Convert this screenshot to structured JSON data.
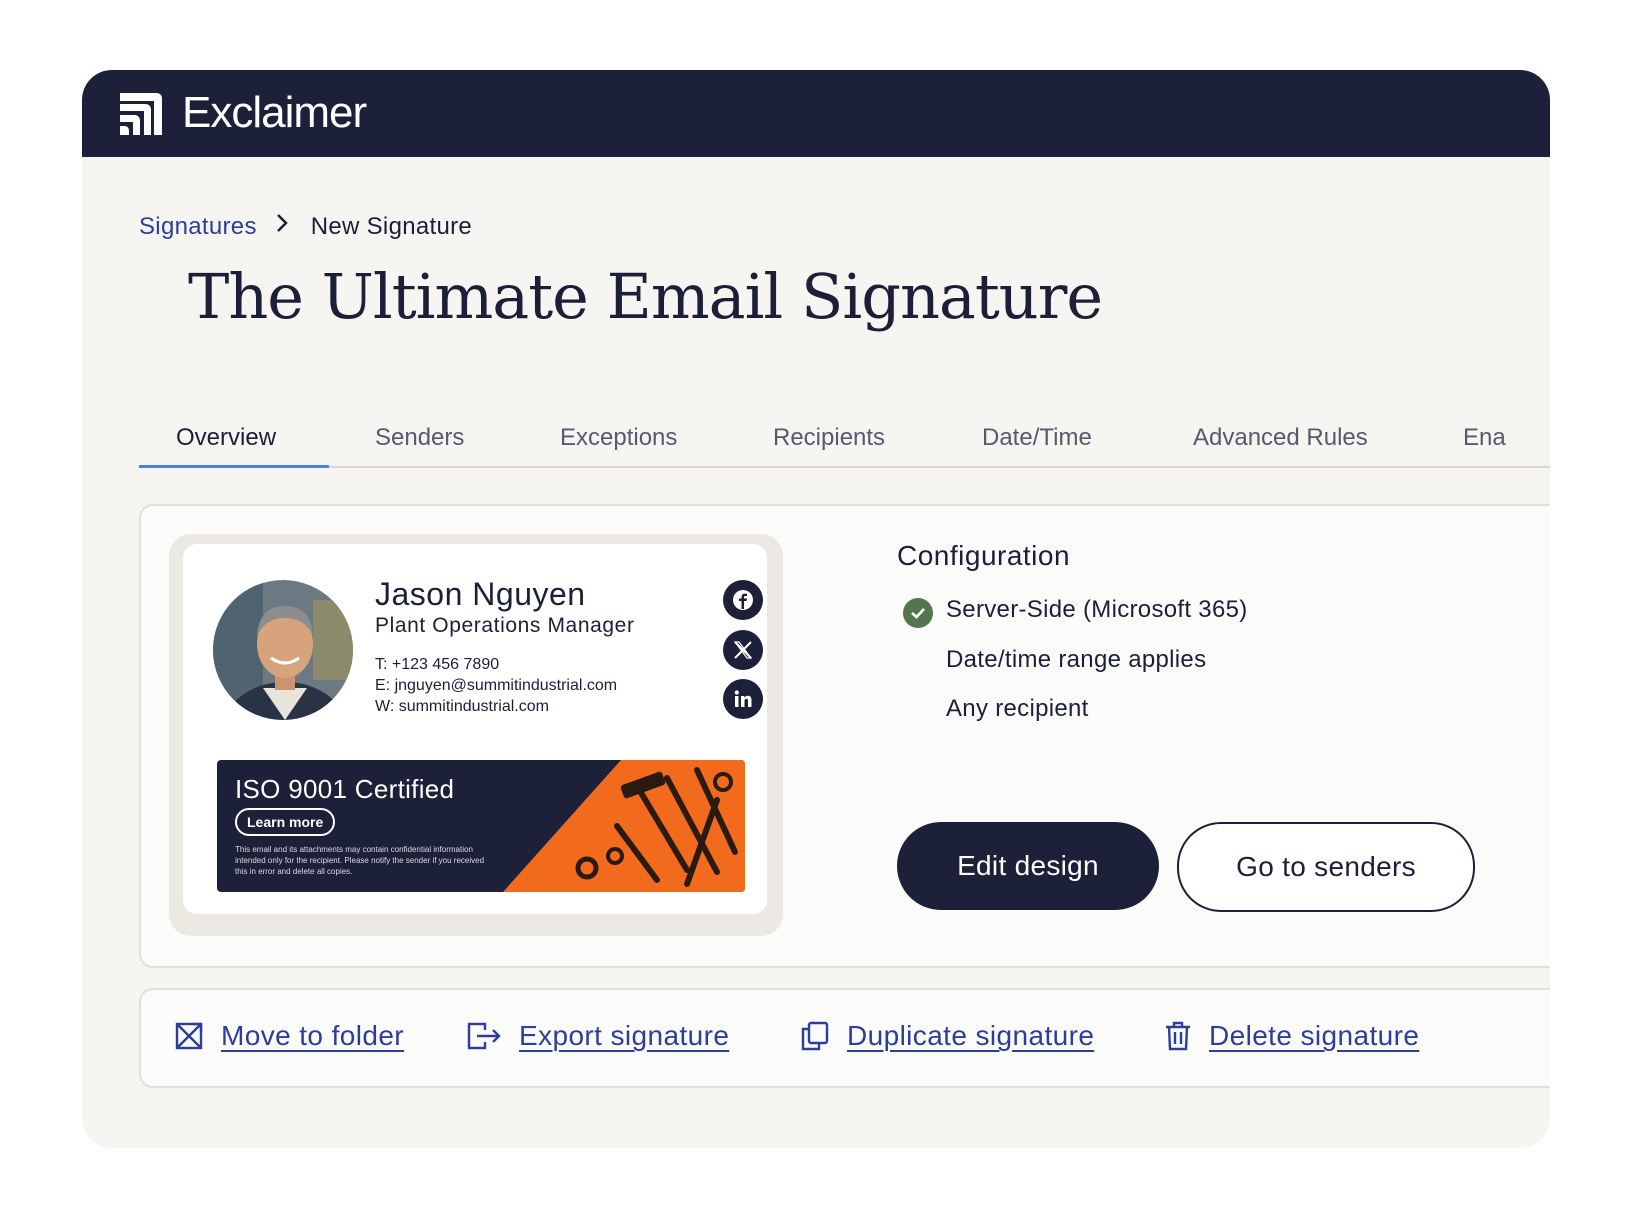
{
  "app": {
    "name": "Exclaimer",
    "logo_icon": "exclaimer-logo-icon"
  },
  "breadcrumb": {
    "parent": "Signatures",
    "current": "New Signature"
  },
  "page_title": "The Ultimate Email Signature",
  "tabs": [
    {
      "label": "Overview",
      "active": true
    },
    {
      "label": "Senders"
    },
    {
      "label": "Exceptions"
    },
    {
      "label": "Recipients"
    },
    {
      "label": "Date/Time"
    },
    {
      "label": "Advanced Rules"
    },
    {
      "label": "Ena"
    }
  ],
  "signature": {
    "name": "Jason Nguyen",
    "role": "Plant Operations Manager",
    "phone": "T: +123 456 7890",
    "email": "E: jnguyen@summitindustrial.com",
    "web": "W: summitindustrial.com",
    "social": [
      "facebook-icon",
      "x-icon",
      "linkedin-icon"
    ],
    "banner": {
      "title": "ISO 9001 Certified",
      "button": "Learn more",
      "note": "This email and its attachments may contain confidential information intended only for the recipient. Please notify the sender if you received this in error and delete all copies."
    }
  },
  "configuration": {
    "title": "Configuration",
    "items": [
      "Server-Side (Microsoft 365)",
      "Date/time range applies",
      "Any recipient"
    ]
  },
  "buttons": {
    "edit": "Edit design",
    "senders": "Go to senders"
  },
  "actions": [
    {
      "label": "Move to folder",
      "icon": "move-icon"
    },
    {
      "label": "Export signature",
      "icon": "export-icon"
    },
    {
      "label": "Duplicate signature",
      "icon": "duplicate-icon"
    },
    {
      "label": "Delete signature",
      "icon": "trash-icon"
    }
  ],
  "colors": {
    "navy": "#1c2038",
    "link": "#2c3e9a",
    "accent_orange": "#f26b1d",
    "check_green": "#54764f",
    "tab_underline": "#4a7de0"
  }
}
